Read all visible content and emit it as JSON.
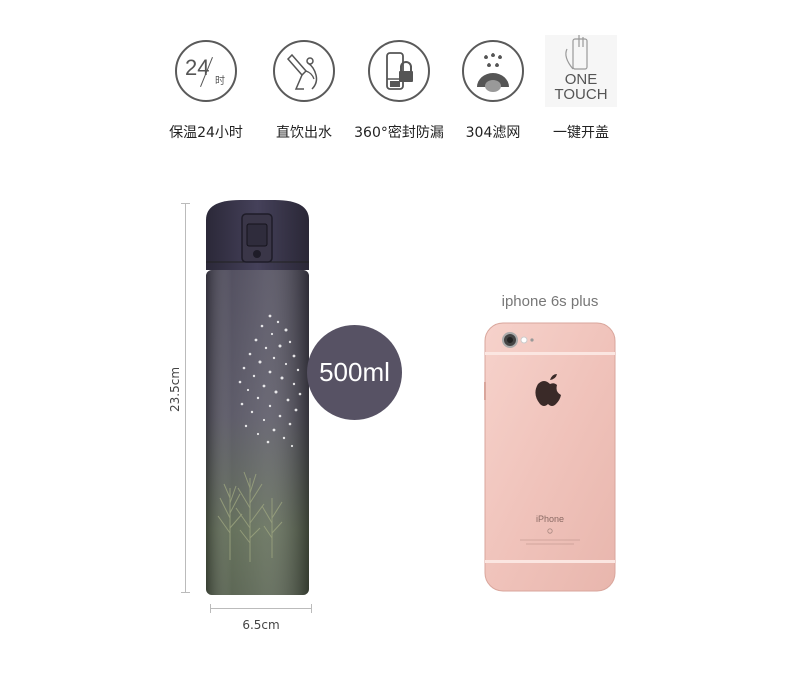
{
  "features": [
    {
      "icon": "clock-24h-icon",
      "icon_text": "24",
      "icon_sub": "时",
      "label": "保温24小时"
    },
    {
      "icon": "drink-icon",
      "label": "直饮出水"
    },
    {
      "icon": "lock-seal-icon",
      "label": "360°密封防漏"
    },
    {
      "icon": "filter-icon",
      "label": "304滤网"
    },
    {
      "icon": "one-touch-icon",
      "icon_text_1": "ONE",
      "icon_text_2": "TOUCH",
      "label": "一键开盖"
    }
  ],
  "bottle": {
    "height_label": "23.5cm",
    "width_label": "6.5cm",
    "capacity": "500ml",
    "colors": {
      "cap": "#3d3a4d",
      "body_top": "#4a4858",
      "body_bottom": "#5d6a52"
    }
  },
  "phone": {
    "caption": "iphone 6s plus",
    "brand_text": "iPhone",
    "color": "#f2c6be"
  }
}
